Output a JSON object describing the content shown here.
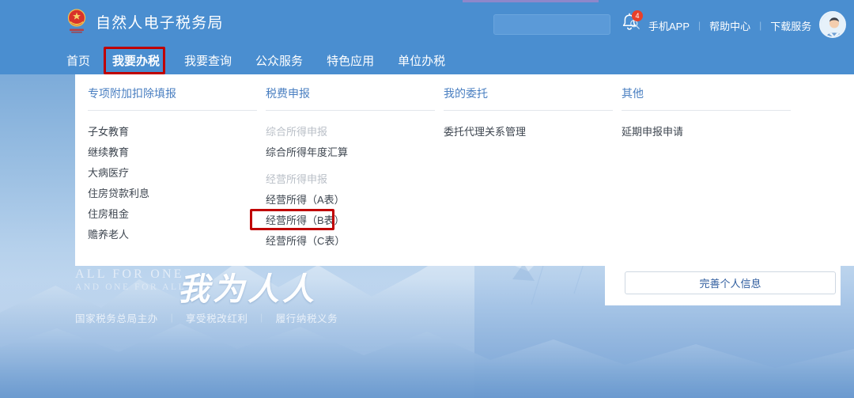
{
  "site": {
    "title": "自然人电子税务局",
    "emblem_icon": "tax-bureau-emblem-icon"
  },
  "header": {
    "search": {
      "value": "",
      "placeholder": "",
      "icon": "search-icon"
    },
    "notification": {
      "icon": "bell-icon",
      "badge": "4"
    },
    "links": [
      {
        "label": "手机APP"
      },
      {
        "label": "帮助中心"
      },
      {
        "label": "下载服务"
      }
    ],
    "separator": "|",
    "avatar_icon": "user-avatar-icon"
  },
  "nav": {
    "items": [
      {
        "label": "首页",
        "active": false
      },
      {
        "label": "我要办税",
        "active": true
      },
      {
        "label": "我要查询",
        "active": false
      },
      {
        "label": "公众服务",
        "active": false
      },
      {
        "label": "特色应用",
        "active": false
      },
      {
        "label": "单位办税",
        "active": false
      }
    ]
  },
  "dropdown": {
    "columns": [
      {
        "title": "专项附加扣除填报",
        "items": [
          {
            "label": "子女教育",
            "muted": false
          },
          {
            "label": "继续教育",
            "muted": false
          },
          {
            "label": "大病医疗",
            "muted": false
          },
          {
            "label": "住房贷款利息",
            "muted": false
          },
          {
            "label": "住房租金",
            "muted": false
          },
          {
            "label": "赡养老人",
            "muted": false
          }
        ]
      },
      {
        "title": "税费申报",
        "items": [
          {
            "label": "综合所得申报",
            "muted": true
          },
          {
            "label": "综合所得年度汇算",
            "muted": false
          },
          {
            "label": "经营所得申报",
            "muted": true,
            "gap": true
          },
          {
            "label": "经营所得（A表）",
            "muted": false
          },
          {
            "label": "经营所得（B表）",
            "muted": false,
            "highlighted": true
          },
          {
            "label": "经营所得（C表）",
            "muted": false
          }
        ]
      },
      {
        "title": "我的委托",
        "items": [
          {
            "label": "委托代理关系管理",
            "muted": false
          }
        ]
      },
      {
        "title": "其他",
        "items": [
          {
            "label": "延期申报申请",
            "muted": false
          }
        ]
      }
    ]
  },
  "slogan": {
    "en_line1": "ALL FOR ONE",
    "en_line2": "AND ONE FOR ALL",
    "cn": "我为人人",
    "footer": [
      {
        "label": "国家税务总局主办"
      },
      {
        "label": "享受税改红利"
      },
      {
        "label": "履行纳税义务"
      }
    ],
    "divider": "|"
  },
  "side_card": {
    "button_label": "完善个人信息"
  },
  "annotations": {
    "highlight_color": "#c00000",
    "boxes": [
      {
        "target": "我要办税"
      },
      {
        "target": "经营所得（B表）"
      }
    ]
  },
  "colors": {
    "header_blue": "#4a8ed0",
    "accent_link": "#4a7fc1",
    "badge_red": "#e8402a",
    "button_text": "#2f5d9e"
  }
}
